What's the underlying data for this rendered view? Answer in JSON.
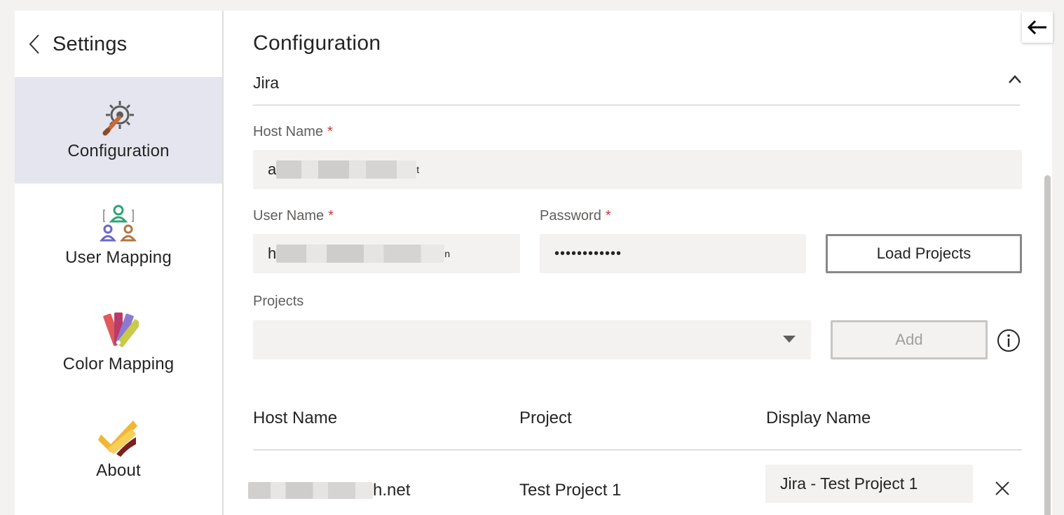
{
  "sidebar": {
    "title": "Settings",
    "items": [
      {
        "label": "Configuration",
        "icon": "wrench-gear-icon",
        "active": true
      },
      {
        "label": "User Mapping",
        "icon": "user-mapping-icon",
        "active": false
      },
      {
        "label": "Color Mapping",
        "icon": "color-palette-icon",
        "active": false
      },
      {
        "label": "About",
        "icon": "about-checkmark-icon",
        "active": false
      }
    ]
  },
  "main": {
    "title": "Configuration",
    "section": {
      "title": "Jira",
      "expanded": true
    },
    "host_name": {
      "label": "Host Name",
      "value_prefix": "a",
      "value_suffix": "t"
    },
    "user_name": {
      "label": "User Name",
      "value_prefix": "h",
      "value_suffix": "n"
    },
    "password": {
      "label": "Password",
      "value": "••••••••••••"
    },
    "load_projects_label": "Load Projects",
    "projects": {
      "label": "Projects",
      "selected": ""
    },
    "add_label": "Add",
    "table": {
      "headers": [
        "Host Name",
        "Project",
        "Display Name"
      ],
      "rows": [
        {
          "host_suffix": "h.net",
          "project": "Test Project 1",
          "display_name": "Jira - Test Project 1"
        }
      ]
    }
  },
  "colors": {
    "active_nav_bg": "#e5e5f0",
    "required": "#d13438",
    "field_bg": "#f3f2f1"
  }
}
